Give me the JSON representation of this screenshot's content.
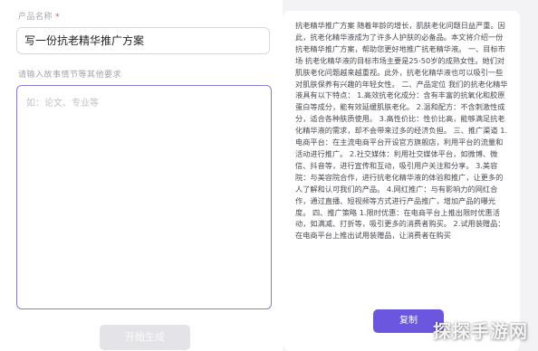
{
  "form": {
    "name_label": "产品名称",
    "required_mark": "*",
    "name_value": "写一份抗老精华推广方案",
    "prompt_label": "请输入故事情节等其他要求",
    "prompt_placeholder": "如：论文、专业等",
    "generate_label": "开始生成"
  },
  "output": {
    "text": "抗老精华推广方案 随着年龄的增长，肌肤老化问题日益严重。因此，抗老化精华液成为了许多人护肤的必备品。本文将介绍一份抗老精华推广方案，帮助您更好地推广抗老精华液。 一、目标市场 抗老化精华液的目标市场主要是25-50岁的成熟女性。她们对肌肤老化问题越来越重视。此外，抗老化精华液也可以吸引一些对肌肤保养有兴趣的年轻女性。 二、产品定位 我们的抗老化精华液具有以下特点： 1.高效抗老化成分：含有丰富的抗氧化和胶原蛋白等成分，能有效延缓肌肤老化。 2.温和配方：不含刺激性成分，适合各种肤质使用。 3.高性价比：性价比高，能够满足抗老化精华液的需求，却不会带来过多的经济负担。 三、推广渠道 1.电商平台：在主流电商平台开设官方旗舰店，利用平台的流量和活动进行推广。 2.社交媒体：利用社交媒体平台，如微博、微信、抖音等，进行宣传和互动，吸引用户关注和分享。 3.美容院：与美容院合作，进行抗老化精华液的体验和推广，让更多的人了解和认可我们的产品。 4.网红推广：与有影响力的网红合作，通过直播、短视频等方式进行产品推广，增加产品的曝光度。 四、推广策略 1.限时优惠：在电商平台上推出限时优惠活动，如满减、打折等，吸引更多的消费者购买。 2.试用装赠品：在电商平台上推出试用装赠品，让消费者在购买",
    "copy_label": "复制"
  },
  "watermark": "探探手游网",
  "colors": {
    "accent": "#6b56e0",
    "focus_border": "#8b7bd8",
    "required": "#e5484d",
    "disabled_button": "#e4e4e8"
  }
}
